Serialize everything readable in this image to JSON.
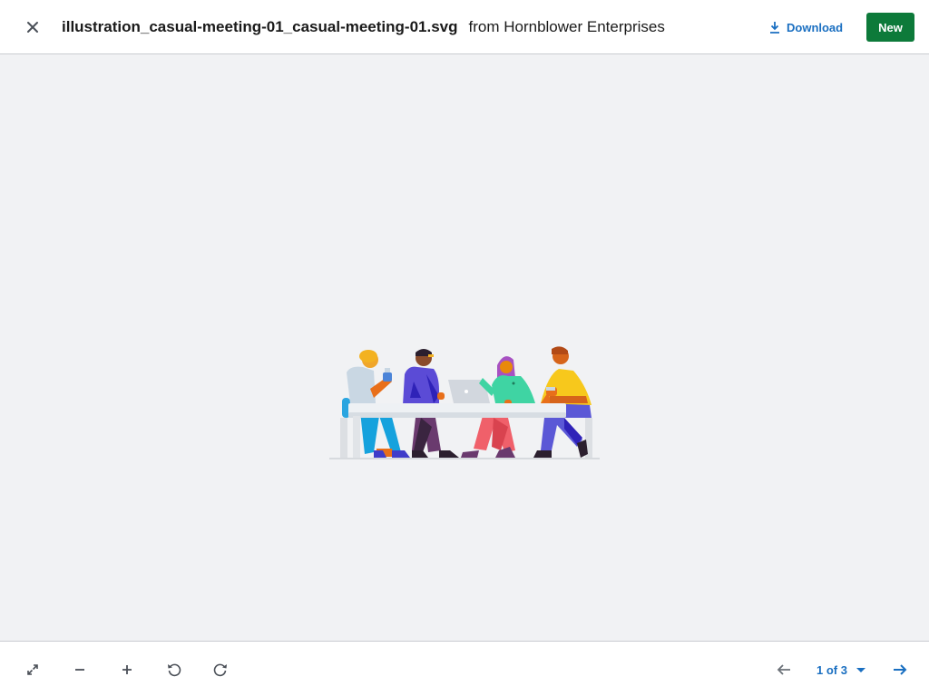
{
  "header": {
    "filename": "illustration_casual-meeting-01_casual-meeting-01.svg",
    "source": "from Hornblower Enterprises",
    "download_label": "Download",
    "new_label": "New"
  },
  "viewer": {
    "illustration": "casual-meeting-illustration"
  },
  "toolbar": {
    "tools": [
      "expand-icon",
      "zoom-out-icon",
      "zoom-in-icon",
      "rotate-left-icon",
      "rotate-right-icon"
    ],
    "page_indicator": "1 of 3"
  },
  "colors": {
    "accent": "#1a6fc1",
    "new_button": "#0d7a3a",
    "background": "#f1f2f4"
  }
}
